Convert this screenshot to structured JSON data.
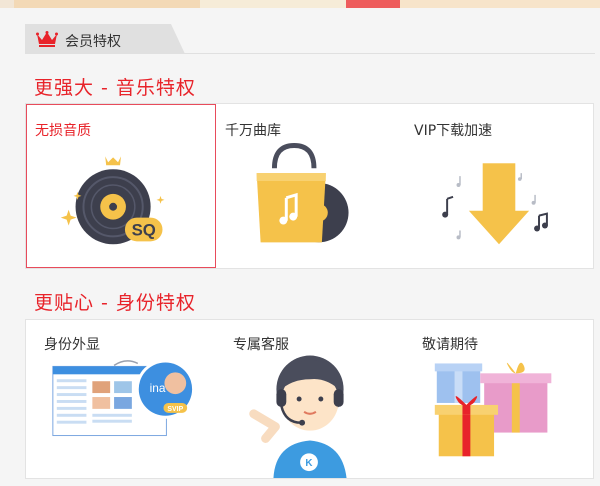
{
  "member_bar": {
    "title": "会员特权"
  },
  "sections": [
    {
      "title": "更强大 - 音乐特权",
      "cards": [
        {
          "label": "无损音质",
          "badge": "SQ",
          "selected": true
        },
        {
          "label": "千万曲库"
        },
        {
          "label": "VIP下载加速"
        }
      ]
    },
    {
      "title": "更贴心 - 身份特权",
      "cards": [
        {
          "label": "身份外显",
          "preview_name": "ina",
          "preview_badge": "SVIP"
        },
        {
          "label": "专属客服"
        },
        {
          "label": "敬请期待"
        }
      ]
    }
  ],
  "colors": {
    "accent": "#e8232a",
    "gold": "#f5c24a",
    "disc": "#3d3f4d"
  }
}
